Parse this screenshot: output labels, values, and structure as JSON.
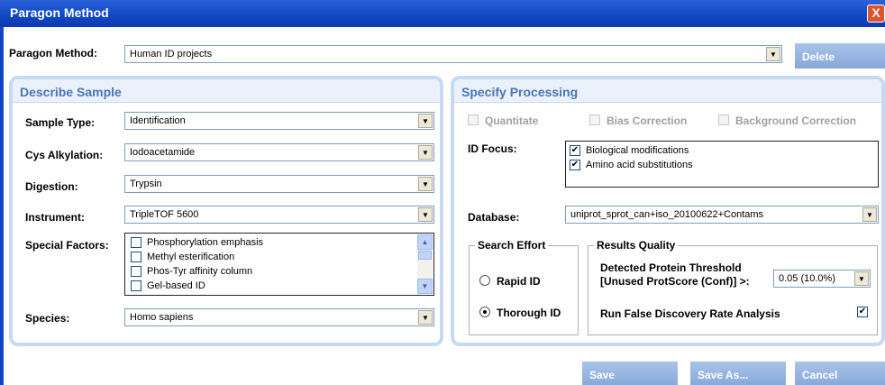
{
  "window": {
    "title": "Paragon Method",
    "close_glyph": "X"
  },
  "method": {
    "label": "Paragon Method:",
    "value": "Human ID projects",
    "delete_label": "Delete"
  },
  "describe": {
    "header": "Describe Sample",
    "sample_type": {
      "label": "Sample Type:",
      "value": "Identification"
    },
    "cys": {
      "label": "Cys Alkylation:",
      "value": "Iodoacetamide"
    },
    "digestion": {
      "label": "Digestion:",
      "value": "Trypsin"
    },
    "instrument": {
      "label": "Instrument:",
      "value": "TripleTOF 5600"
    },
    "special": {
      "label": "Special Factors:",
      "items": [
        {
          "label": "Phosphorylation emphasis",
          "checked": false
        },
        {
          "label": "Methyl esterification",
          "checked": false
        },
        {
          "label": "Phos-Tyr affinity column",
          "checked": false
        },
        {
          "label": "Gel-based ID",
          "checked": false
        }
      ]
    },
    "species": {
      "label": "Species:",
      "value": "Homo sapiens"
    }
  },
  "processing": {
    "header": "Specify Processing",
    "quantitate": "Quantitate",
    "bias": "Bias Correction",
    "background": "Background Correction",
    "id_focus": {
      "label": "ID Focus:",
      "items": [
        {
          "label": "Biological modifications",
          "checked": true
        },
        {
          "label": "Amino acid substitutions",
          "checked": true
        }
      ]
    },
    "database": {
      "label": "Database:",
      "value": "uniprot_sprot_can+iso_20100622+Contams"
    },
    "search_effort": {
      "title": "Search Effort",
      "rapid": "Rapid ID",
      "thorough": "Thorough ID",
      "selected": "Thorough ID"
    },
    "results_quality": {
      "title": "Results Quality",
      "threshold_line1": "Detected Protein Threshold",
      "threshold_line2": "[Unused ProtScore (Conf)] >:",
      "threshold_value": "0.05 (10.0%)",
      "fdr_label": "Run False Discovery Rate Analysis",
      "fdr_checked": true
    }
  },
  "footer": {
    "save": "Save",
    "save_as": "Save As...",
    "cancel": "Cancel"
  },
  "glyphs": {
    "check": "✔",
    "down": "▼",
    "up": "▲"
  }
}
